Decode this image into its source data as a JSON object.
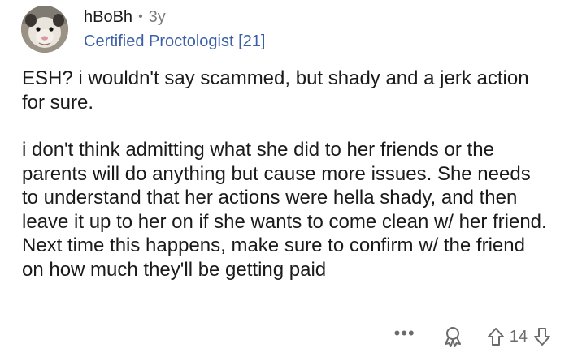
{
  "comment": {
    "username": "hBoBh",
    "separator": "•",
    "age": "3y",
    "flair": "Certified Proctologist [21]",
    "paragraphs": [
      "ESH? i wouldn't say scammed, but shady and a jerk action for sure.",
      "i don't think admitting what she did to her friends or the parents will do anything but cause more issues. She needs to understand that her actions were hella shady, and then leave it up to her on if she wants to come clean w/ her friend. Next time this happens, make sure to confirm w/ the friend on how much they'll be getting paid"
    ],
    "actions": {
      "more_label": "•••",
      "score": "14"
    }
  },
  "icons": {
    "avatar": "opossum-avatar",
    "award": "award-icon",
    "upvote": "upvote-arrow-icon",
    "downvote": "downvote-arrow-icon"
  },
  "colors": {
    "flair": "#3a5fa8",
    "muted": "#7c7c7c",
    "text": "#1a1a1b"
  }
}
